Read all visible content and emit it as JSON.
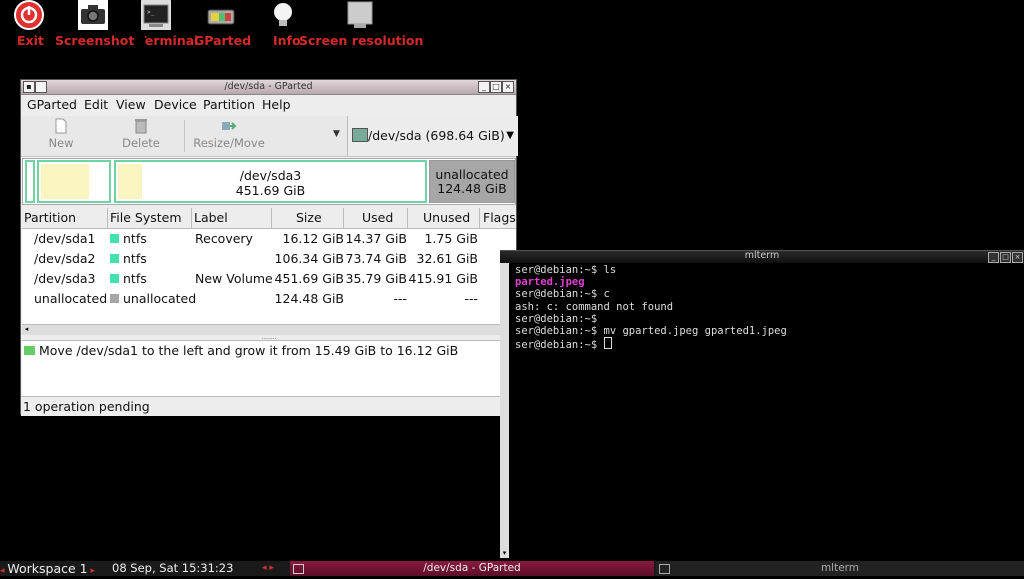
{
  "desktop": {
    "icons": [
      {
        "label": "Exit",
        "icon": "power-icon"
      },
      {
        "label": "Screenshot",
        "icon": "camera-icon"
      },
      {
        "label": "Terminal",
        "icon": "terminal-icon"
      },
      {
        "label": "GParted",
        "icon": "gparted-icon"
      },
      {
        "label": "Info",
        "icon": "lightbulb-icon"
      },
      {
        "label": "Screen resolution",
        "icon": "monitor-icon"
      }
    ]
  },
  "gparted": {
    "title": "/dev/sda - GParted",
    "menu": [
      "GParted",
      "Edit",
      "View",
      "Device",
      "Partition",
      "Help"
    ],
    "toolbar": {
      "new": "New",
      "delete": "Delete",
      "resize": "Resize/Move"
    },
    "device": "/dev/sda  (698.64 GiB)",
    "diskbar": {
      "sda3_name": "/dev/sda3",
      "sda3_size": "451.69 GiB",
      "unalloc_name": "unallocated",
      "unalloc_size": "124.48 GiB"
    },
    "columns": [
      "Partition",
      "File System",
      "Label",
      "Size",
      "Used",
      "Unused",
      "Flags"
    ],
    "rows": [
      {
        "partition": "/dev/sda1",
        "fs": "ntfs",
        "label": "Recovery",
        "size": "16.12 GiB",
        "used": "14.37 GiB",
        "unused": "1.75 GiB"
      },
      {
        "partition": "/dev/sda2",
        "fs": "ntfs",
        "label": "",
        "size": "106.34 GiB",
        "used": "73.74 GiB",
        "unused": "32.61 GiB"
      },
      {
        "partition": "/dev/sda3",
        "fs": "ntfs",
        "label": "New Volume",
        "size": "451.69 GiB",
        "used": "35.79 GiB",
        "unused": "415.91 GiB"
      },
      {
        "partition": "unallocated",
        "fs": "unallocated",
        "label": "",
        "size": "124.48 GiB",
        "used": "---",
        "unused": "---"
      }
    ],
    "operation": "Move /dev/sda1 to the left and grow it from 15.49 GiB to 16.12 GiB",
    "status": "1 operation pending"
  },
  "terminal": {
    "title": "mlterm",
    "lines": [
      {
        "text": "ser@debian:~$ ls",
        "style": ""
      },
      {
        "text": "parted.jpeg",
        "style": "pink"
      },
      {
        "text": "ser@debian:~$ c",
        "style": ""
      },
      {
        "text": "ash: c: command not found",
        "style": ""
      },
      {
        "text": "ser@debian:~$",
        "style": ""
      },
      {
        "text": "ser@debian:~$ mv gparted.jpeg gparted1.jpeg",
        "style": ""
      },
      {
        "text": "ser@debian:~$ ",
        "style": "cursor"
      }
    ]
  },
  "taskbar": {
    "workspace": "Workspace 1",
    "clock": "08 Sep, Sat 15:31:23",
    "tasks": [
      "/dev/sda - GParted",
      "mlterm"
    ]
  },
  "colors": {
    "icon_label": "#d42a2a",
    "ntfs": "#43e0b0",
    "unallocated": "#a6a6a6",
    "task_active": "#7a1a3a"
  }
}
